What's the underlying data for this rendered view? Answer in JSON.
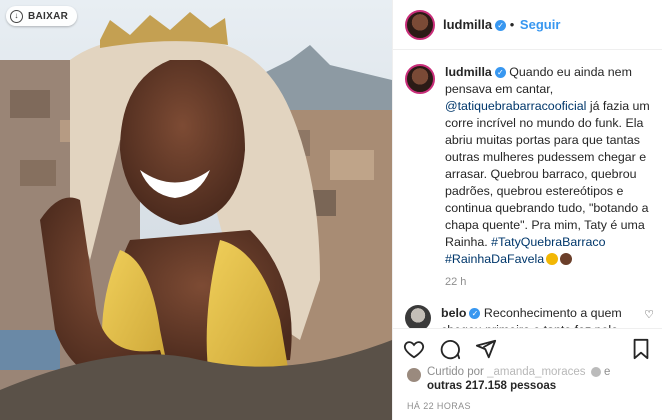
{
  "download_button": {
    "label": "BAIXAR"
  },
  "post": {
    "username": "ludmilla",
    "follow_label": "Seguir",
    "caption": {
      "username": "ludmilla",
      "text_1": " Quando eu ainda nem pensava em cantar, ",
      "mention": "@tatiquebrabarracooficial",
      "text_2": " já fazia um corre incrível no mundo do funk. Ela abriu muitas portas para que tantas outras mulheres pudessem chegar e arrasar. Quebrou barraco, quebrou padrões, quebrou estereótipos e continua quebrando tudo, \"botando a chapa quente\". Pra mim, Taty é uma Rainha. ",
      "hashtag_1": "#TatyQuebraBarraco",
      "hashtag_2": "#RainhaDaFavela",
      "time": "22 h"
    },
    "comment": {
      "username": "belo",
      "text": " Reconhecimento a quem chegou primeiro e tanto fez pelo movimento !!isso é pra poucos !! Orgulho Lud Parabéns filha"
    },
    "liked_by": {
      "prefix": "Curtido por ",
      "user": "_amanda_moraces",
      "others": "outras 217.158 pessoas"
    },
    "timestamp": "HÁ 22 HORAS"
  },
  "colors": {
    "accent": "#3897f0",
    "link": "#00376b",
    "muted": "#8e8e8e"
  },
  "icons": [
    "download-icon",
    "verified-icon",
    "heart-icon",
    "comment-icon",
    "share-icon",
    "bookmark-icon"
  ]
}
